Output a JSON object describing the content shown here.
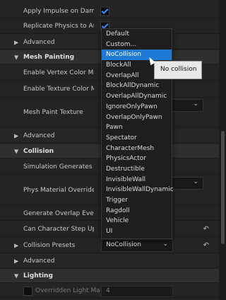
{
  "rows": {
    "apply_impulse": {
      "label": "Apply Impulse on Damage",
      "checked": true
    },
    "replicate_physics": {
      "label": "Replicate Physics to Aut...",
      "checked": true
    },
    "advanced1": "Advanced",
    "mesh_painting": "Mesh Painting",
    "enable_vertex_color": "Enable Vertex Color Mes...",
    "enable_texture_color": "Enable Texture Color Me...",
    "mesh_paint_texture": "Mesh Paint Texture",
    "advanced2": "Advanced",
    "collision": "Collision",
    "sim_generates_hit": "Simulation Generates Hi...",
    "phys_material_override": "Phys Material Override",
    "generate_overlap": "Generate Overlap Events",
    "can_step_up": "Can Character Step Up On",
    "collision_presets": {
      "label": "Collision Presets",
      "value": "NoCollision"
    },
    "advanced3": "Advanced",
    "lighting": "Lighting",
    "overridden_light": {
      "label": "Overridden Light Ma...",
      "value": "4"
    }
  },
  "dropdown": {
    "options": [
      "Default",
      "Custom...",
      "NoCollision",
      "BlockAll",
      "OverlapAll",
      "BlockAllDynamic",
      "OverlapAllDynamic",
      "IgnoreOnlyPawn",
      "OverlapOnlyPawn",
      "Pawn",
      "Spectator",
      "CharacterMesh",
      "PhysicsActor",
      "Destructible",
      "InvisibleWall",
      "InvisibleWallDynamic",
      "Trigger",
      "Ragdoll",
      "Vehicle",
      "UI"
    ],
    "selected": "NoCollision"
  },
  "tooltip": "No collision",
  "icons": {
    "arrow_right": "▶",
    "arrow_down": "▼",
    "chevron_down": "⌄",
    "reset": "↶"
  },
  "colors": {
    "accent": "#1f7ad6",
    "check": "#3d8bff"
  }
}
